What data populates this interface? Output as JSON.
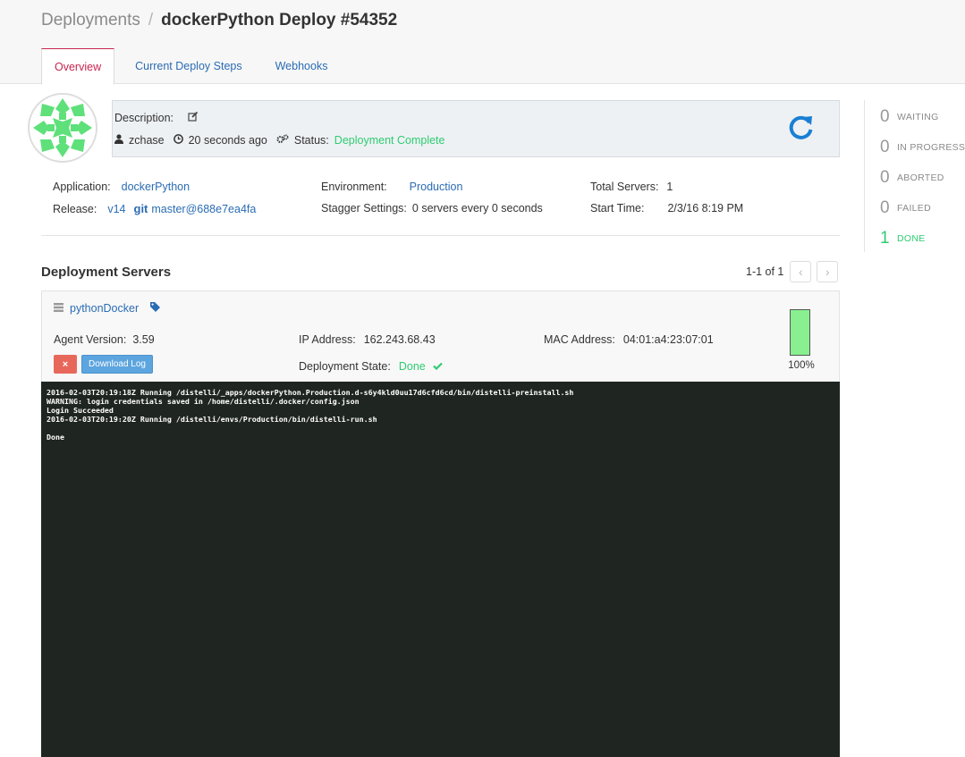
{
  "breadcrumb": {
    "root": "Deployments",
    "separator": "/",
    "current": "dockerPython Deploy #54352"
  },
  "tabs": [
    {
      "label": "Overview",
      "active": true
    },
    {
      "label": "Current Deploy Steps",
      "active": false
    },
    {
      "label": "Webhooks",
      "active": false
    }
  ],
  "summary": {
    "description_label": "Description:",
    "user": "zchase",
    "time_ago": "20 seconds ago",
    "status_label": "Status:",
    "status_value": "Deployment Complete"
  },
  "details": {
    "application_label": "Application:",
    "application_value": "dockerPython",
    "release_label": "Release:",
    "release_version": "v14",
    "git_label": "git",
    "release_commit": "master@688e7ea4fa",
    "environment_label": "Environment:",
    "environment_value": "Production",
    "stagger_label": "Stagger Settings:",
    "stagger_value": "0 servers every 0 seconds",
    "total_servers_label": "Total Servers:",
    "total_servers_value": "1",
    "start_time_label": "Start Time:",
    "start_time_value": "2/3/16 8:19 PM"
  },
  "stats": [
    {
      "count": "0",
      "label": "WAITING"
    },
    {
      "count": "0",
      "label": "IN PROGRESS"
    },
    {
      "count": "0",
      "label": "ABORTED"
    },
    {
      "count": "0",
      "label": "FAILED"
    },
    {
      "count": "1",
      "label": "DONE"
    }
  ],
  "servers": {
    "title": "Deployment Servers",
    "pager_text": "1-1 of 1",
    "server": {
      "name": "pythonDocker",
      "agent_version_label": "Agent Version:",
      "agent_version_value": "3.59",
      "ip_label": "IP Address:",
      "ip_value": "162.243.68.43",
      "mac_label": "MAC Address:",
      "mac_value": "04:01:a4:23:07:01",
      "state_label": "Deployment State:",
      "state_value": "Done",
      "cancel_label": "×",
      "download_label": "Download Log",
      "progress": 1.0,
      "progress_label": "100%"
    }
  },
  "log": "2016-02-03T20:19:18Z Running /distelli/_apps/dockerPython.Production.d-s6y4kld0uu17d6cfd6cd/bin/distelli-preinstall.sh\nWARNING: login credentials saved in /home/distelli/.docker/config.json\nLogin Succeeded\n2016-02-03T20:19:20Z Running /distelli/envs/Production/bin/distelli-run.sh\n\nDone",
  "colors": {
    "link": "#2b6cb3",
    "success": "#2ecc71",
    "active_tab": "#c7254e",
    "danger": "#e7685b",
    "primary_button": "#5da5df",
    "log_background": "#1f2520",
    "progress_fill": "#88f08f"
  }
}
